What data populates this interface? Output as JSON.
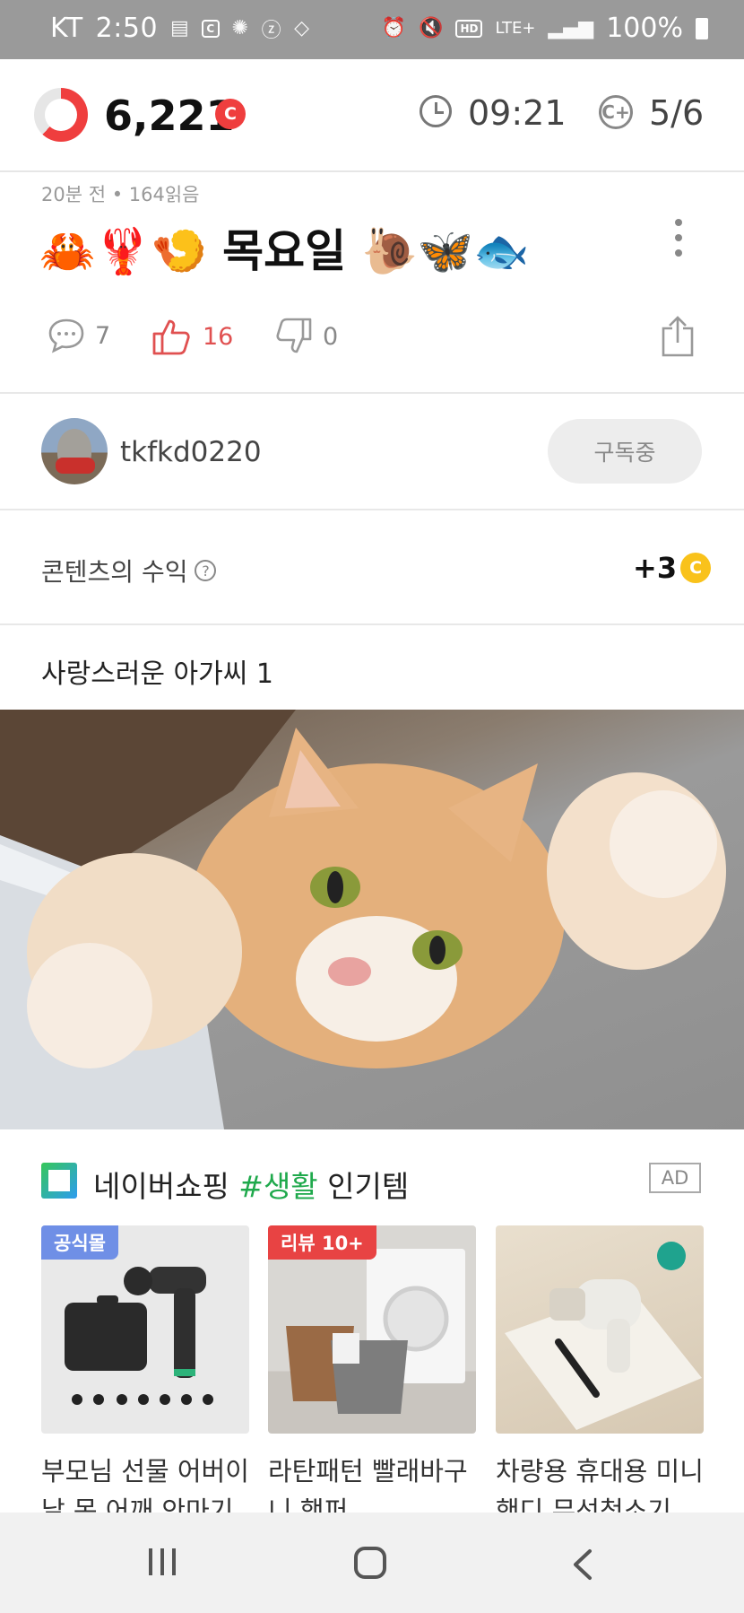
{
  "status_bar": {
    "carrier": "KT",
    "time": "2:50",
    "left_icons": [
      "cash-feed-icon",
      "cash-icon",
      "aperture-icon",
      "z-icon",
      "diamond-icon"
    ],
    "hd_label": "HD",
    "network": "LTE+",
    "battery": "100%"
  },
  "header": {
    "coin_count": "6,221",
    "coin_symbol": "C",
    "timer": "09:21",
    "progress": "5/6",
    "ring_progress": 0.62,
    "accent_color": "#ef3e3e"
  },
  "post": {
    "meta": "20분 전 • 164읽음",
    "title": "🦀🦞🍤 목요일 🐌🦋🐟",
    "comments": "7",
    "likes": "16",
    "dislikes": "0"
  },
  "author": {
    "username": "tkfkd0220",
    "subscribe_label": "구독중"
  },
  "revenue": {
    "label": "콘텐츠의 수익",
    "help": "?",
    "value": "+3",
    "coin_symbol": "C"
  },
  "content": {
    "text": "사랑스러운 아가씨 1"
  },
  "ad": {
    "title_prefix": "네이버쇼핑 ",
    "title_hash": "#생활",
    "title_suffix": " 인기템",
    "badge": "AD",
    "products": [
      {
        "tag": "공식몰",
        "name_line1": "부모님 선물 어버이",
        "name_line2": "날 목 어깨 안마기"
      },
      {
        "tag": "리뷰 10+",
        "name_line1": "라탄패턴 빨래바구",
        "name_line2": "니 햄퍼"
      },
      {
        "tag": "",
        "name_line1": "차량용 휴대용 미니",
        "name_line2": "핸디 무선청소기"
      }
    ]
  }
}
